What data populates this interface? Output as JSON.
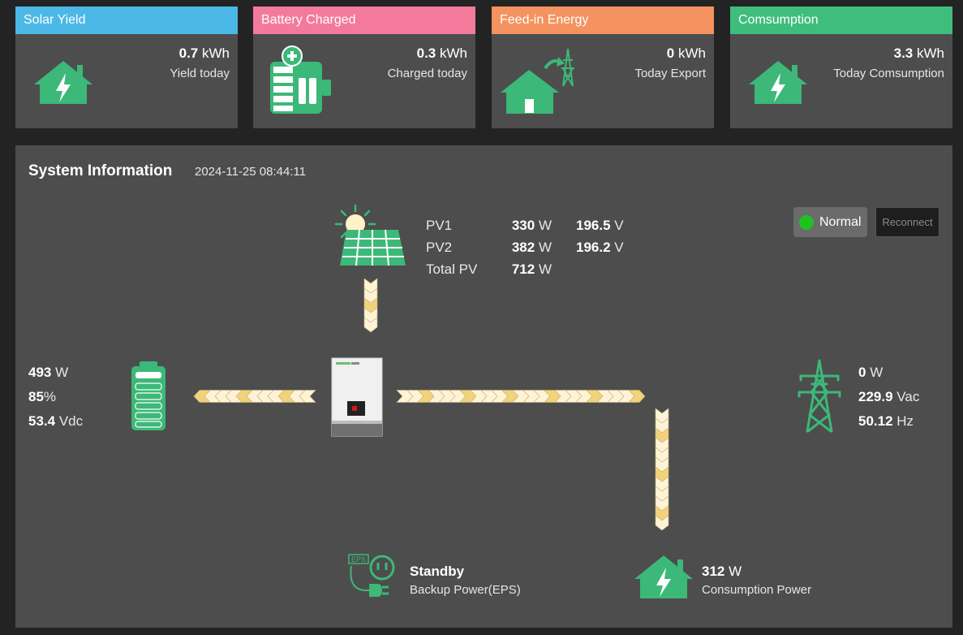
{
  "cards": [
    {
      "title": "Solar Yield",
      "value": "0.7",
      "unit": "kWh",
      "sub": "Yield today",
      "color": "#4cb8e6",
      "icon": "house-bolt-icon"
    },
    {
      "title": "Battery Charged",
      "value": "0.3",
      "unit": "kWh",
      "sub": "Charged today",
      "color": "#f47a9c",
      "icon": "battery-charge-icon"
    },
    {
      "title": "Feed-in Energy",
      "value": "0",
      "unit": "kWh",
      "sub": "Today Export",
      "color": "#f4935f",
      "icon": "house-grid-export-icon"
    },
    {
      "title": "Comsumption",
      "value": "3.3",
      "unit": "kWh",
      "sub": "Today Comsumption",
      "color": "#3ebd7c",
      "icon": "house-bolt-icon"
    }
  ],
  "system": {
    "title": "System Information",
    "timestamp": "2024-11-25 08:44:11",
    "status": "Normal",
    "status_color": "#1ec21e",
    "reconnect_label": "Reconnect"
  },
  "pv": [
    {
      "label": "PV1",
      "watts": "330",
      "w_unit": "W",
      "volts": "196.5",
      "v_unit": "V"
    },
    {
      "label": "PV2",
      "watts": "382",
      "w_unit": "W",
      "volts": "196.2",
      "v_unit": "V"
    },
    {
      "label": "Total PV",
      "watts": "712",
      "w_unit": "W"
    }
  ],
  "battery": {
    "power": "493",
    "power_unit": "W",
    "soc": "85",
    "soc_unit": "%",
    "voltage": "53.4",
    "voltage_unit": "Vdc"
  },
  "grid": {
    "power": "0",
    "power_unit": "W",
    "voltage": "229.9",
    "voltage_unit": "Vac",
    "frequency": "50.12",
    "frequency_unit": "Hz"
  },
  "eps": {
    "status": "Standby",
    "label": "Backup Power(EPS)",
    "badge": "EPS"
  },
  "consumption": {
    "power": "312",
    "power_unit": "W",
    "label": "Consumption Power"
  },
  "colors": {
    "accent_green": "#3cb878",
    "flow_light": "#fff3d6",
    "flow_dark": "#f2d27a"
  }
}
